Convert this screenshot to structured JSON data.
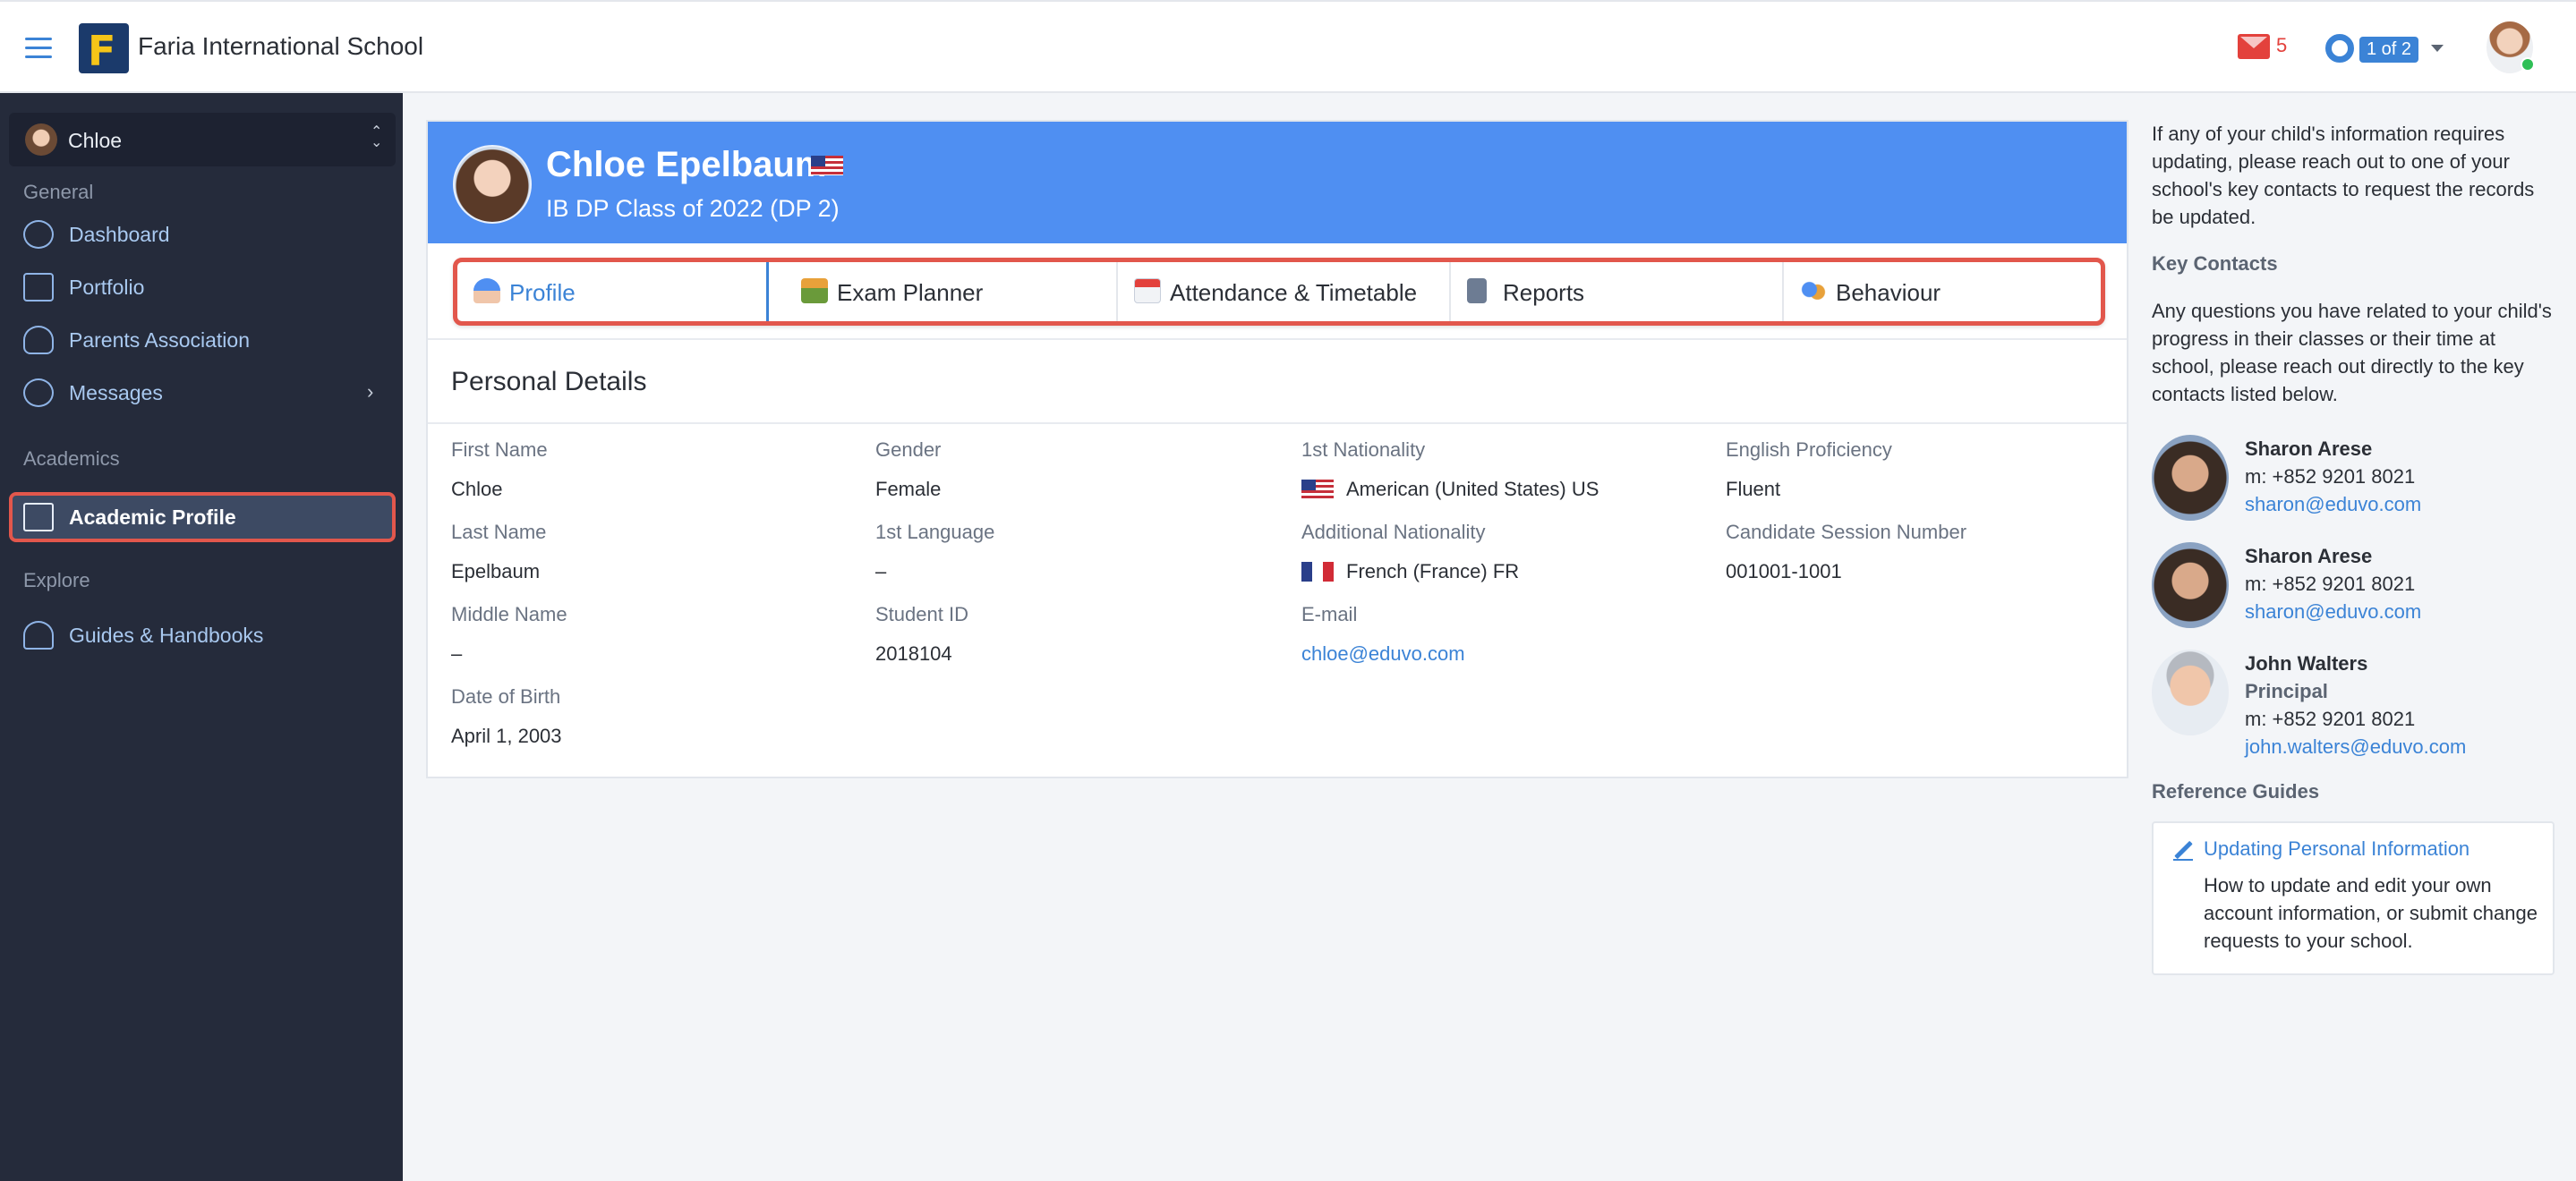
{
  "app": {
    "school_name": "Faria International School",
    "logo_letter": "F",
    "mail_count": "5",
    "pager": "1 of 2",
    "colors": {
      "accent": "#3b83d6",
      "banner": "#4f8ff2",
      "sidebar": "#252b3b",
      "highlight": "#e2574c",
      "mail": "#e3413c",
      "online": "#2fbf56"
    }
  },
  "sidebar": {
    "child": "Chloe",
    "general_label": "General",
    "general_items": [
      {
        "label": "Dashboard",
        "icon": "dashboard-icon"
      },
      {
        "label": "Portfolio",
        "icon": "briefcase-icon"
      },
      {
        "label": "Parents Association",
        "icon": "users-icon"
      },
      {
        "label": "Messages",
        "icon": "chat-icon",
        "has_submenu": true
      }
    ],
    "academics_label": "Academics",
    "academics_items": [
      {
        "label": "Academic Profile",
        "icon": "document-icon",
        "active": true
      }
    ],
    "explore_label": "Explore",
    "explore_items": [
      {
        "label": "Guides & Handbooks",
        "icon": "guides-icon"
      }
    ]
  },
  "student": {
    "name": "Chloe Epelbaum",
    "class": "IB DP Class of 2022 (DP 2)"
  },
  "tabs": [
    {
      "label": "Profile",
      "icon": "profile-icon",
      "active": true
    },
    {
      "label": "Exam Planner",
      "icon": "exam-icon"
    },
    {
      "label": "Attendance & Timetable",
      "icon": "calendar-icon"
    },
    {
      "label": "Reports",
      "icon": "reports-icon"
    },
    {
      "label": "Behaviour",
      "icon": "behaviour-icon"
    }
  ],
  "personal": {
    "title": "Personal Details",
    "first_name_label": "First Name",
    "first_name": "Chloe",
    "last_name_label": "Last Name",
    "last_name": "Epelbaum",
    "middle_name_label": "Middle Name",
    "middle_name": "–",
    "dob_label": "Date of Birth",
    "dob": "April 1, 2003",
    "gender_label": "Gender",
    "gender": "Female",
    "language_label": "1st Language",
    "language": "–",
    "student_id_label": "Student ID",
    "student_id": "2018104",
    "nationality_label": "1st Nationality",
    "nationality": "American (United States) US",
    "add_nationality_label": "Additional Nationality",
    "add_nationality": "French (France) FR",
    "email_label": "E-mail",
    "email": "chloe@eduvo.com",
    "english_label": "English Proficiency",
    "english": "Fluent",
    "session_label": "Candidate Session Number",
    "session": "001001-1001"
  },
  "right_panel": {
    "intro": "If any of your child's information requires updating, please reach out to one of your school's key contacts to request the records be updated.",
    "key_contacts_heading": "Key Contacts",
    "key_contacts_text": "Any questions you have related to your child's progress in their classes or their time at school, please reach out directly to the key contacts listed below.",
    "contacts": [
      {
        "name": "Sharon Arese",
        "phone": "m: +852 9201 8021",
        "email": "sharon@eduvo.com"
      },
      {
        "name": "Sharon Arese",
        "phone": "m: +852 9201 8021",
        "email": "sharon@eduvo.com"
      },
      {
        "name": "John Walters",
        "role": "Principal",
        "phone": "m: +852 9201 8021",
        "email": "john.walters@eduvo.com"
      }
    ],
    "reference_heading": "Reference Guides",
    "guide_title": "Updating Personal Information",
    "guide_desc": "How to update and edit your own account information, or submit change requests to your school."
  }
}
